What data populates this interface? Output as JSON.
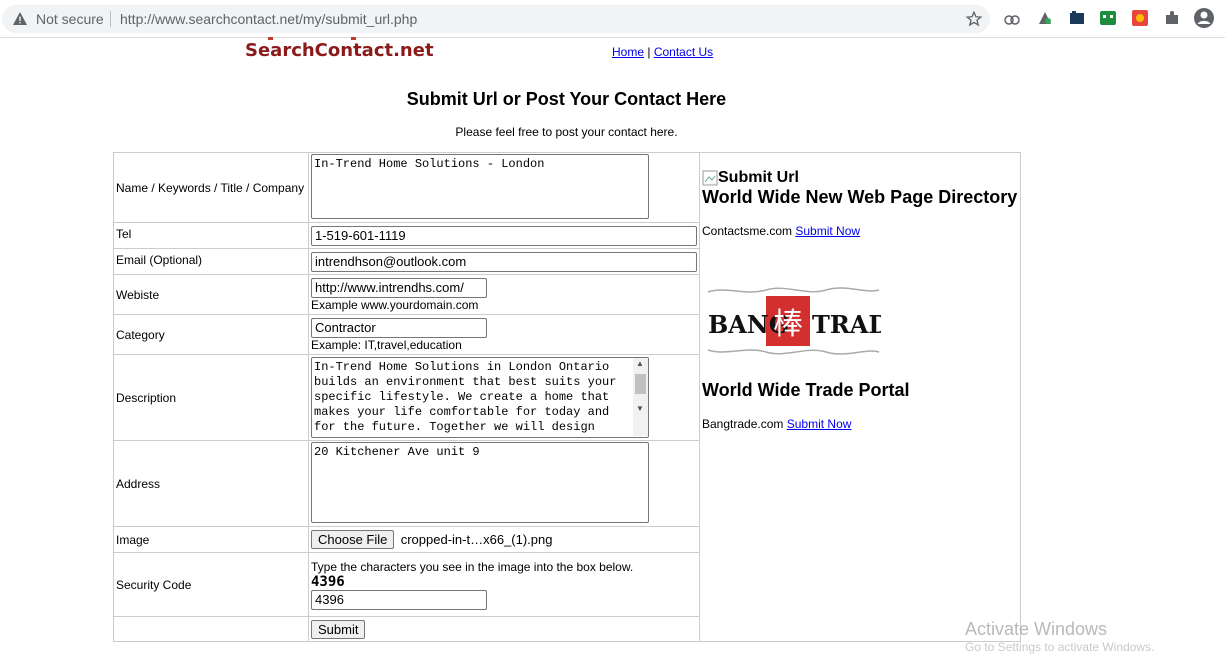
{
  "browser": {
    "security_label": "Not secure",
    "url": "http://www.searchcontact.net/my/submit_url.php"
  },
  "site": {
    "logo": "SearchContact.net",
    "nav": {
      "home": "Home",
      "separator": "|",
      "contact": "Contact Us"
    }
  },
  "page": {
    "title": "Submit Url or Post Your Contact Here",
    "subtitle": "Please feel free to post your contact here."
  },
  "form": {
    "name_label": "Name / Keywords / Title / Company",
    "name_value": "In-Trend Home Solutions - London",
    "tel_label": "Tel",
    "tel_value": "1-519-601-1119",
    "email_label": "Email (Optional)",
    "email_value": "intrendhson@outlook.com",
    "website_label": "Webiste",
    "website_value": "http://www.intrendhs.com/",
    "website_hint": "Example www.yourdomain.com",
    "category_label": "Category",
    "category_value": "Contractor",
    "category_hint": "Example: IT,travel,education",
    "description_label": "Description",
    "description_value": "In-Trend Home Solutions in London Ontario builds an environment that best suits your specific lifestyle. We create a home that makes your life comfortable for today and for the future. Together we will design",
    "address_label": "Address",
    "address_value": "20 Kitchener Ave unit 9",
    "image_label": "Image",
    "choose_file": "Choose File",
    "file_name": "cropped-in-t…x66_(1).png",
    "security_label": "Security Code",
    "security_hint": "Type the characters you see in the image into the box below.",
    "captcha_text": "4396",
    "security_value": "4396",
    "submit": "Submit"
  },
  "sidebar": {
    "submit_img_alt": "Submit Url",
    "directory_title": "World Wide New Web Page Directory",
    "directory_site": "Contactsme.com",
    "directory_link": "Submit Now",
    "bang_logo_left": "BANG",
    "bang_logo_char": "棒",
    "bang_logo_right": "TRADE",
    "trade_title": "World Wide Trade Portal",
    "trade_site": "Bangtrade.com",
    "trade_link": "Submit Now"
  },
  "os": {
    "watermark": "Activate Windows",
    "watermark_sub": "Go to Settings to activate Windows."
  },
  "colors": {
    "logo": "#8b1a1a",
    "link": "#0000ee",
    "bang_red": "#d32f2f"
  }
}
